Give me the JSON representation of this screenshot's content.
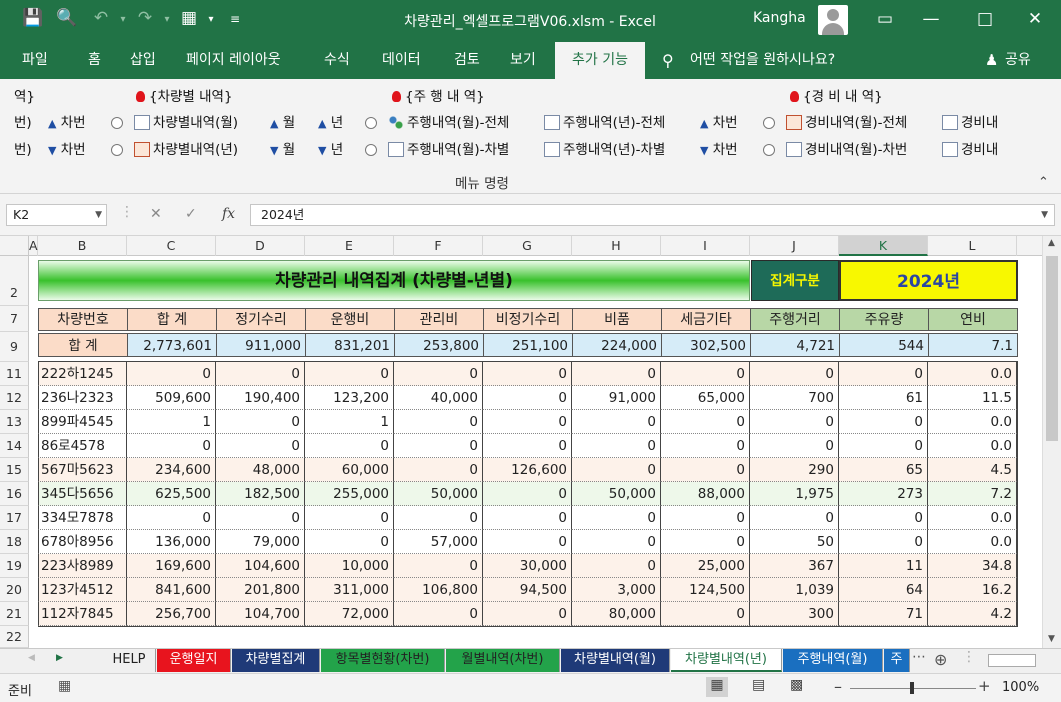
{
  "window": {
    "title": "차량관리_엑셀프로그램V06.xlsm  -  Excel",
    "user": "Kangha"
  },
  "colors": {
    "excel_green": "#217346",
    "title_band": "#39c12c",
    "total_row": "#d6ecf8",
    "header_row": "#fbdcc8",
    "header_green": "#b8d7a6"
  },
  "tabs": [
    "파일",
    "홈",
    "삽입",
    "페이지 레이아웃",
    "수식",
    "데이터",
    "검토",
    "보기",
    "추가 기능"
  ],
  "tell_me": "어떤 작업을 원하시나요?",
  "share": "공유",
  "ribbon": {
    "cut_top": "역}",
    "cut_r1": "번)",
    "cut_r2": "번)",
    "arrow_label": "차번",
    "g1_title": "{차량별 내역}",
    "g1_r1": "차량별내역(월)",
    "g1_r2": "차량별내역(년)",
    "month": "월",
    "year": "년",
    "g2_title": "{주 행 내 역}",
    "g2_r1a": "주행내역(월)-전체",
    "g2_r1b": "주행내역(년)-전체",
    "g2_r2a": "주행내역(월)-차별",
    "g2_r2b": "주행내역(년)-차별",
    "g3_title": "{경 비 내 역}",
    "g3_r1a": "경비내역(월)-전체",
    "g3_r1b": "경비내",
    "g3_r2a": "경비내역(월)-차번",
    "g3_r2b": "경비내",
    "group_label": "메뉴 명령"
  },
  "formula_bar": {
    "cell_ref": "K2",
    "value": "2024년",
    "fx": "fx"
  },
  "columns": [
    "A",
    "B",
    "C",
    "D",
    "E",
    "F",
    "G",
    "H",
    "I",
    "J",
    "K",
    "L"
  ],
  "sheet": {
    "title": "차량관리 내역집계 (차량별-년별)",
    "agg_label": "집계구분",
    "agg_value": "2024년",
    "headers": [
      "차량번호",
      "합  계",
      "정기수리",
      "운행비",
      "관리비",
      "비정기수리",
      "비품",
      "세금기타",
      "주행거리",
      "주유량",
      "연비"
    ],
    "total_row": [
      "합  계",
      "2,773,601",
      "911,000",
      "831,201",
      "253,800",
      "251,100",
      "224,000",
      "302,500",
      "4,721",
      "544",
      "7.1"
    ],
    "rows": [
      [
        "222하1245",
        "0",
        "0",
        "0",
        "0",
        "0",
        "0",
        "0",
        "0",
        "0",
        "0.0"
      ],
      [
        "236나2323",
        "509,600",
        "190,400",
        "123,200",
        "40,000",
        "0",
        "91,000",
        "65,000",
        "700",
        "61",
        "11.5"
      ],
      [
        "899파4545",
        "1",
        "0",
        "1",
        "0",
        "0",
        "0",
        "0",
        "0",
        "0",
        "0.0"
      ],
      [
        "86로4578",
        "0",
        "0",
        "0",
        "0",
        "0",
        "0",
        "0",
        "0",
        "0",
        "0.0"
      ],
      [
        "567마5623",
        "234,600",
        "48,000",
        "60,000",
        "0",
        "126,600",
        "0",
        "0",
        "290",
        "65",
        "4.5"
      ],
      [
        "345다5656",
        "625,500",
        "182,500",
        "255,000",
        "50,000",
        "0",
        "50,000",
        "88,000",
        "1,975",
        "273",
        "7.2"
      ],
      [
        "334모7878",
        "0",
        "0",
        "0",
        "0",
        "0",
        "0",
        "0",
        "0",
        "0",
        "0.0"
      ],
      [
        "678아8956",
        "136,000",
        "79,000",
        "0",
        "57,000",
        "0",
        "0",
        "0",
        "50",
        "0",
        "0.0"
      ],
      [
        "223사8989",
        "169,600",
        "104,600",
        "10,000",
        "0",
        "30,000",
        "0",
        "25,000",
        "367",
        "11",
        "34.8"
      ],
      [
        "123가4512",
        "841,600",
        "201,800",
        "311,000",
        "106,800",
        "94,500",
        "3,000",
        "124,500",
        "1,039",
        "64",
        "16.2"
      ],
      [
        "112자7845",
        "256,700",
        "104,700",
        "72,000",
        "0",
        "0",
        "80,000",
        "0",
        "300",
        "71",
        "4.2"
      ]
    ],
    "row_numbers": [
      "2",
      "7",
      "9",
      "11",
      "12",
      "13",
      "14",
      "15",
      "16",
      "17",
      "18",
      "19",
      "20",
      "21",
      "22"
    ]
  },
  "sheet_tabs": [
    "HELP",
    "운행일지",
    "차량별집계",
    "항목별현황(차번)",
    "월별내역(차번)",
    "차량별내역(월)",
    "차량별내역(년)",
    "주행내역(월)",
    "주"
  ],
  "status": {
    "ready": "준비",
    "zoom": "100%"
  }
}
